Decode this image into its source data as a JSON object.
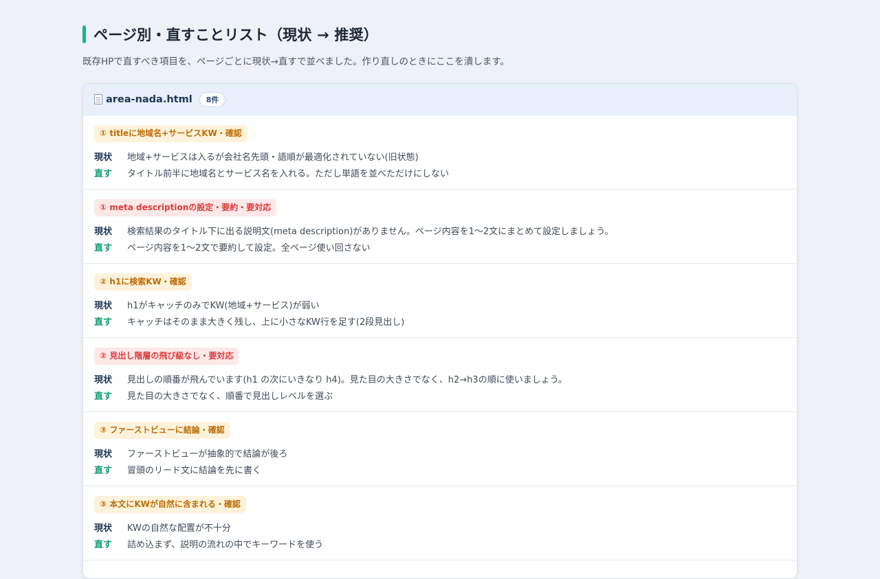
{
  "page": {
    "title": "ページ別・直すことリスト（現状 → 推奨）",
    "subtitle": "既存HPで直すべき項目を、ページごとに現状→直すで並べました。作り直しのときにここを潰します。"
  },
  "file_card": {
    "icon": "file-icon",
    "file_name": "area-nada.html",
    "count": "8件",
    "labels": {
      "current": "現状",
      "fix": "直す"
    },
    "issues": [
      {
        "tag": "① titleに地域名+サービスKW・確認",
        "tone": "check",
        "current": "地域+サービスは入るが会社名先頭・語順が最適化されていない(旧状態)",
        "fix": "タイトル前半に地域名とサービス名を入れる。ただし単語を並べただけにしない"
      },
      {
        "tag": "① meta descriptionの設定・要約・要対応",
        "tone": "urgent",
        "current": "検索結果のタイトル下に出る説明文(meta description)がありません。ページ内容を1〜2文にまとめて設定しましょう。",
        "fix": "ページ内容を1〜2文で要約して設定。全ページ使い回さない"
      },
      {
        "tag": "② h1に検索KW・確認",
        "tone": "check",
        "current": "h1がキャッチのみでKW(地域+サービス)が弱い",
        "fix": "キャッチはそのまま大きく残し、上に小さなKW行を足す(2段見出し)"
      },
      {
        "tag": "② 見出し階層の飛び級なし・要対応",
        "tone": "urgent",
        "current": "見出しの順番が飛んでいます(h1 の次にいきなり h4)。見た目の大きさでなく、h2→h3の順に使いましょう。",
        "fix": "見た目の大きさでなく、順番で見出しレベルを選ぶ"
      },
      {
        "tag": "③ ファーストビューに結論・確認",
        "tone": "check",
        "current": "ファーストビューが抽象的で結論が後ろ",
        "fix": "冒頭のリード文に結論を先に書く"
      },
      {
        "tag": "③ 本文にKWが自然に含まれる・確認",
        "tone": "check",
        "current": "KWの自然な配置が不十分",
        "fix": "詰め込まず、説明の流れの中でキーワードを使う"
      }
    ]
  },
  "colors": {
    "background": "#eef2f8",
    "accent_bar": "#12b886",
    "card_header": "#e8f1fb",
    "tag_check_bg": "#fdf3dc",
    "tag_check_text": "#bd6d07",
    "tag_urgent_bg": "#fde8e8",
    "tag_urgent_text": "#dc3b3b",
    "label_current": "#1f3552",
    "label_fix": "#0f9d6b"
  }
}
